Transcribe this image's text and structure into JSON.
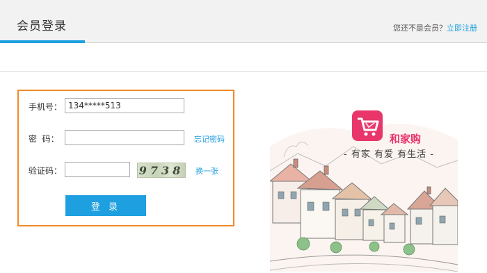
{
  "header": {
    "title": "会员登录",
    "not_member_text": "您还不是会员？",
    "register_link": "立即注册"
  },
  "form": {
    "phone_label": "手机号：",
    "phone_value": "134*****513",
    "password_label": "密  码：",
    "password_value": "",
    "forgot_password": "忘记密码",
    "captcha_label": "验证码：",
    "captcha_value": "",
    "captcha_image_text": "9738",
    "refresh_captcha": "换一张",
    "login_button": "登 录"
  },
  "brand": {
    "name": "和家购",
    "slogan": "- 有家 有爱 有生活 -"
  },
  "colors": {
    "accent": "#1e9fe0",
    "highlight_border": "#f08a2a",
    "brand_pink": "#e8366b"
  }
}
